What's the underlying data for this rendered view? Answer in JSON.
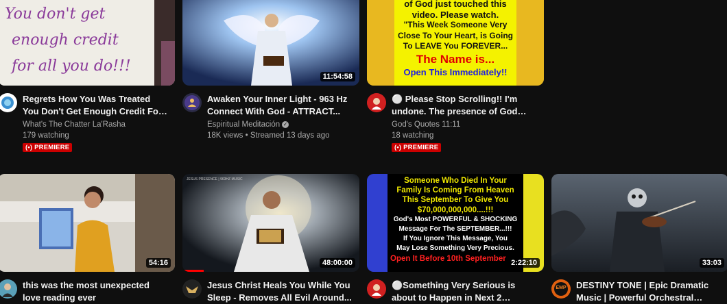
{
  "videos": [
    {
      "title": "Regrets How You Was Treated You Don't Get Enough Credit For All...",
      "channel": "What's The Chatter La'Rasha",
      "stats": "179 watching",
      "badge": "PREMIERE",
      "thumb_text": [
        "You don't get",
        "enough credit",
        "for all you do!!!"
      ],
      "avatar_icon": "globe-icon"
    },
    {
      "title": "Awaken Your Inner Light - 963 Hz Connect With God - ATTRACT...",
      "channel": "Espiritual Meditación",
      "stats": "18K views • Streamed 13 days ago",
      "duration": "11:54:58",
      "avatar_icon": "meditation-icon"
    },
    {
      "title": "⚪ Please Stop Scrolling!! I'm undone. The presence of God jus...",
      "channel": "God's Quotes 11:11",
      "stats": "18 watching",
      "badge": "PREMIERE",
      "thumb_text": [
        "of God just touched this",
        "video. Please watch.",
        "\"This Week Someone Very",
        "Close To Your Heart, is Going",
        "To LEAVE You FOREVER...",
        "The Name is...",
        "Open This Immediately!!"
      ],
      "avatar_icon": "jesus-avatar-icon"
    },
    {
      "title": "this was the most unexpected love reading ever",
      "duration": "54:16",
      "avatar_icon": "person-avatar-icon"
    },
    {
      "title": "Jesus Christ Heals You While You Sleep - Removes All Evil Around...",
      "duration": "48:00:00",
      "progress": 0.12,
      "thumb_text": [
        "JESUS PRESENCE | 963HZ MUSIC"
      ],
      "avatar_icon": "cross-avatar-icon"
    },
    {
      "title": "⚪Something Very Serious is about to Happen in Next 2 Hours...",
      "duration": "2:22:10",
      "thumb_text": [
        "Someone Who Died In Your",
        "Family Is Coming From Heaven",
        "This September To Give You",
        "$70,000,000,000....!!!",
        "God's Most POWERFUL & SHOCKING",
        "Message For The SEPTEMBER...!!!",
        "If You Ignore This Message, You",
        "May Lose Something Very Precious.",
        "Open It Before 10th September"
      ],
      "avatar_icon": "jesus-avatar-icon"
    },
    {
      "title": "DESTINY TONE | Epic Dramatic Music | Powerful Orchestral Musi...",
      "duration": "33:03",
      "avatar_icon": "emp-logo-icon",
      "avatar_text": "EMP"
    }
  ],
  "colors": {
    "background": "#0f0f0f",
    "title": "#f1f1f1",
    "secondary": "#aaaaaa",
    "premiere": "#cc0000",
    "progress": "#ff0000"
  }
}
